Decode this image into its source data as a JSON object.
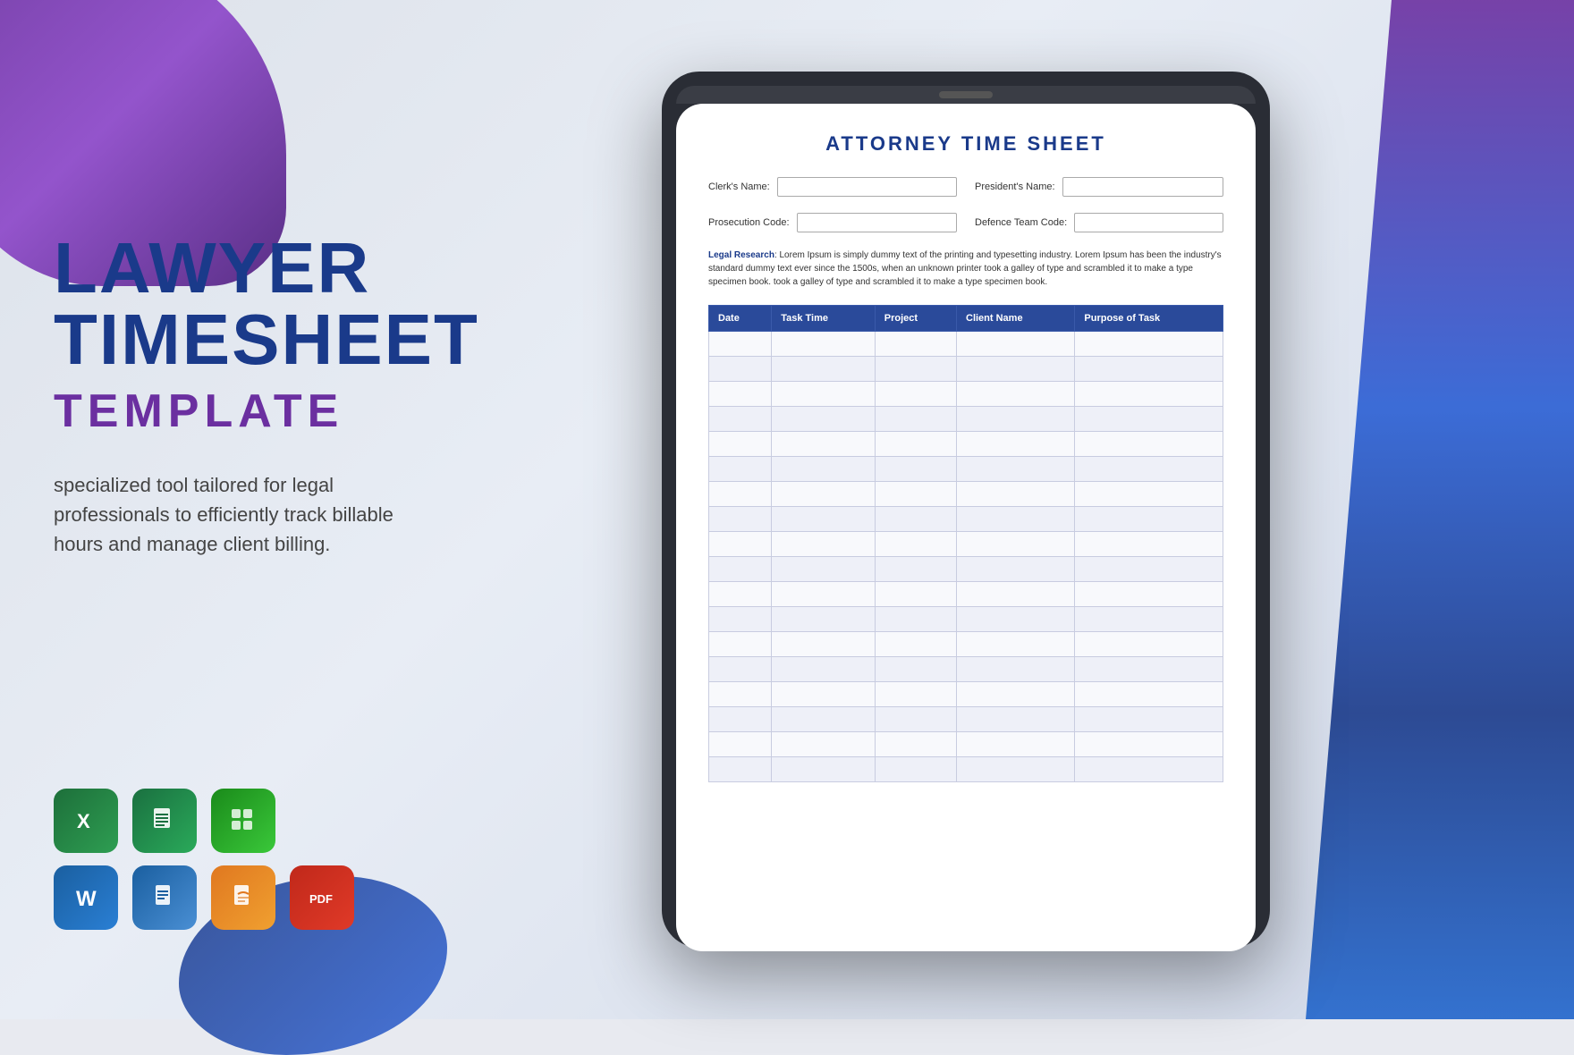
{
  "background": {
    "color": "#e8eaf0"
  },
  "left_panel": {
    "title_line1": "LAWYER",
    "title_line2": "TIMESHEET",
    "title_line3": "TEMPLATE",
    "description": "specialized tool tailored for legal professionals to efficiently track billable hours and manage client billing."
  },
  "app_icons": [
    {
      "name": "Excel",
      "symbol": "X",
      "type": "excel"
    },
    {
      "name": "Google Sheets",
      "symbol": "⊞",
      "type": "sheets"
    },
    {
      "name": "Numbers",
      "symbol": "▦",
      "type": "numbers"
    },
    {
      "name": "Word",
      "symbol": "W",
      "type": "word"
    },
    {
      "name": "Google Docs",
      "symbol": "≡",
      "type": "docs"
    },
    {
      "name": "Pages",
      "symbol": "✎",
      "type": "pages"
    },
    {
      "name": "PDF",
      "symbol": "PDF",
      "type": "pdf"
    }
  ],
  "document": {
    "title": "ATTORNEY TIME SHEET",
    "fields": [
      {
        "label": "Clerk's Name:",
        "id": "clerks-name"
      },
      {
        "label": "President's Name:",
        "id": "presidents-name"
      },
      {
        "label": "Prosecution Code:",
        "id": "prosecution-code"
      },
      {
        "label": "Defence Team Code:",
        "id": "defence-team-code"
      }
    ],
    "legal_research_label": "Legal Research",
    "legal_research_text": ": Lorem Ipsum is simply dummy text of the printing and typesetting industry. Lorem Ipsum has been the industry's standard dummy text ever since the 1500s, when an unknown printer took a galley of type and scrambled it to make a type specimen book. took a galley of type and scrambled it to make a type specimen book.",
    "table": {
      "headers": [
        "Date",
        "Task Time",
        "Project",
        "Client Name",
        "Purpose of Task"
      ],
      "rows": 18
    }
  }
}
